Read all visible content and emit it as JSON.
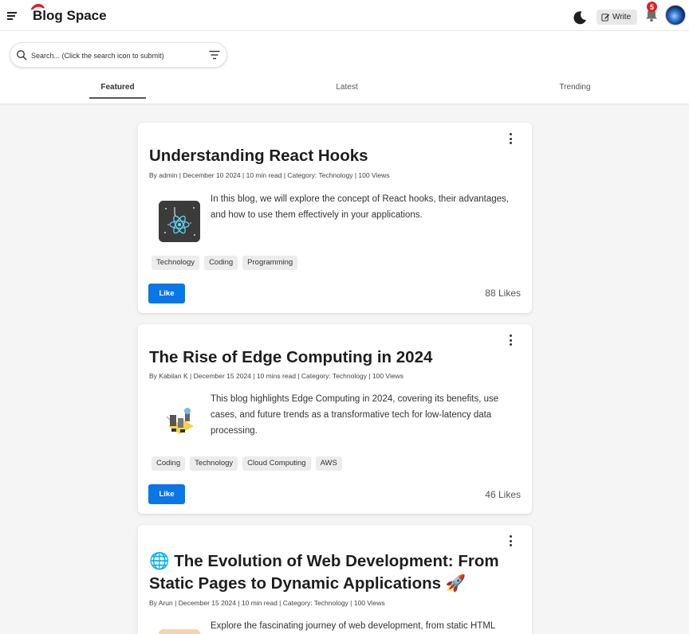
{
  "header": {
    "app_title": "Blog Space",
    "write_label": "Write",
    "notification_count": "5"
  },
  "search": {
    "placeholder": "Search... (Click the search icon to submit)"
  },
  "tabs": [
    {
      "label": "Featured",
      "active": true
    },
    {
      "label": "Latest",
      "active": false
    },
    {
      "label": "Trending",
      "active": false
    }
  ],
  "posts": [
    {
      "title": "Understanding React Hooks",
      "meta": "By admin | December 10 2024 | 10 min read | Category: Technology | 100 Views",
      "description": "In this blog, we will explore the concept of React hooks, their advantages, and how to use them effectively in your applications.",
      "tags": [
        "Technology",
        "Coding",
        "Programming"
      ],
      "like_label": "Like",
      "likes": "88 Likes"
    },
    {
      "title": "The Rise of Edge Computing in 2024",
      "meta": "By Kabilan K | December 15 2024 | 10 mins read | Category: Technology | 100 Views",
      "description": "This blog highlights Edge Computing in 2024, covering its benefits, use cases, and future trends as a transformative tech for low-latency data processing.",
      "tags": [
        "Coding",
        "Technology",
        "Cloud Computing",
        "AWS"
      ],
      "like_label": "Like",
      "likes": "46 Likes"
    },
    {
      "title": "🌐 The Evolution of Web Development: From Static Pages to Dynamic Applications 🚀",
      "meta": "By Arun | December 15 2024 | 10 min read | Category: Technology | 100 Views",
      "description": "Explore the fascinating journey of web development, from static HTML"
    }
  ],
  "colors": {
    "accent": "#0b76e6",
    "badge": "#e0201b"
  }
}
